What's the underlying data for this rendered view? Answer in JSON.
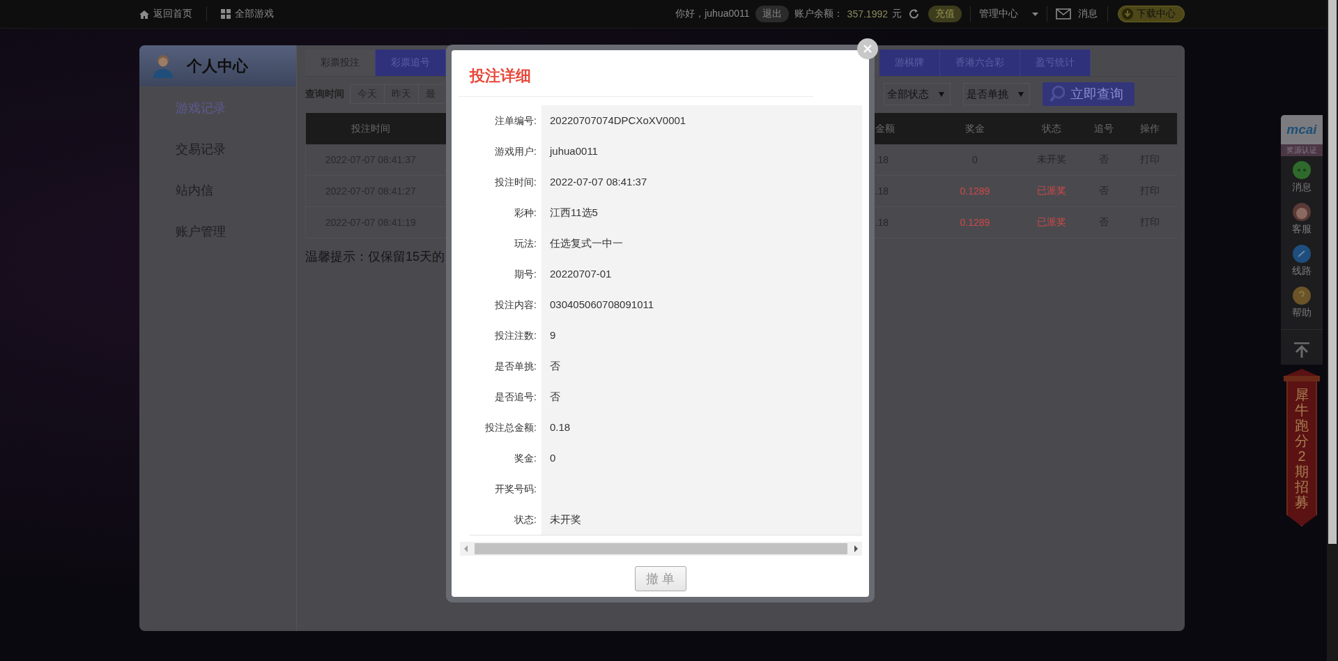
{
  "top_bar": {
    "links": [
      {
        "kind": "home",
        "label": "返回首页"
      },
      {
        "kind": "grid",
        "label": "全部游戏"
      }
    ],
    "greeting": "你好，juhua0011",
    "logout": "退出",
    "balance_label": "账户余额：",
    "balance": "357.1992",
    "currency": "元",
    "recharge": "充值",
    "manage_center": "管理中心",
    "messages": "消息",
    "download": "下载中心"
  },
  "panel": {
    "title": "个人中心",
    "sidebar": [
      {
        "label": "游戏记录",
        "selected": true
      },
      {
        "label": "交易记录",
        "selected": false
      },
      {
        "label": "站内信",
        "selected": false
      },
      {
        "label": "账户管理",
        "selected": false
      }
    ],
    "tabs_left": [
      {
        "label": "彩票投注",
        "selected": true
      },
      {
        "label": "彩票追号",
        "selected": false
      }
    ],
    "tabs_right": [
      {
        "label": "游棋牌",
        "selected": false
      },
      {
        "label": "香港六合彩",
        "selected": false
      },
      {
        "label": "盈亏统计",
        "selected": false
      }
    ],
    "filter": {
      "label": "查询时间",
      "quick": [
        "今天",
        "昨天",
        "最"
      ],
      "selects": [
        "全部状态",
        "是否单挑"
      ],
      "search_button": "立即查询"
    },
    "table": {
      "columns": [
        "投注时间",
        "金额",
        "奖金",
        "状态",
        "追号",
        "操作"
      ],
      "rows": [
        {
          "paid": false,
          "cells": [
            "2022-07-07 08:41:37",
            ".18",
            "0",
            "未开奖",
            "否",
            "打印"
          ]
        },
        {
          "paid": true,
          "cells": [
            "2022-07-07 08:41:27",
            ".18",
            "0.1289",
            "已派奖",
            "否",
            "打印"
          ]
        },
        {
          "paid": true,
          "cells": [
            "2022-07-07 08:41:19",
            ".18",
            "0.1289",
            "已派奖",
            "否",
            "打印"
          ]
        }
      ]
    },
    "hint": "温馨提示：仅保留15天的"
  },
  "dialog": {
    "title": "投注详细",
    "fields": [
      {
        "label": "注单编号:",
        "value": "20220707074DPCXoXV0001"
      },
      {
        "label": "游戏用户:",
        "value": "juhua0011"
      },
      {
        "label": "投注时间:",
        "value": "2022-07-07 08:41:37"
      },
      {
        "label": "彩种:",
        "value": "江西11选5"
      },
      {
        "label": "玩法:",
        "value": "任选复式一中一"
      },
      {
        "label": "期号:",
        "value": "20220707-01"
      },
      {
        "label": "投注内容:",
        "value": "030405060708091011"
      },
      {
        "label": "投注注数:",
        "value": "9"
      },
      {
        "label": "是否单挑:",
        "value": "否"
      },
      {
        "label": "是否追号:",
        "value": "否"
      },
      {
        "label": "投注总金额:",
        "value": "0.18"
      },
      {
        "label": "奖金:",
        "value": "0"
      },
      {
        "label": "开奖号码:"
      },
      {
        "label": "状态:",
        "value": "未开奖"
      }
    ],
    "cancel_button": {
      "label": "撤 单",
      "disabled": true
    }
  },
  "float_bar": {
    "logo": "mcai",
    "badge": "奖源认证",
    "items": [
      {
        "kind": "chat",
        "label": "消息"
      },
      {
        "kind": "service",
        "label": "客服"
      },
      {
        "kind": "route",
        "label": "线路"
      },
      {
        "kind": "help",
        "label": "帮助"
      }
    ],
    "banner": "犀牛跑分2期招募"
  }
}
